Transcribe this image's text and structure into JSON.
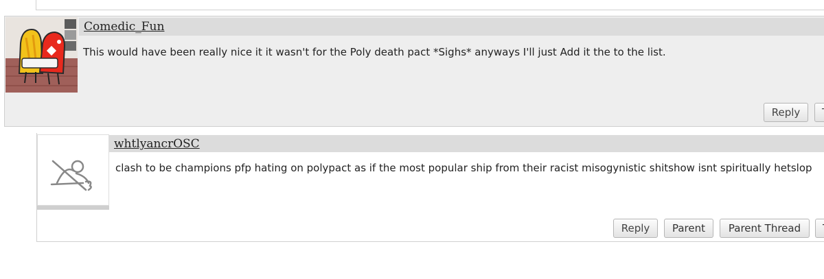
{
  "comments": [
    {
      "username": "Comedic_Fun",
      "text": "This would have been really nice it it wasn't for the Poly death pact *Sighs* anyways I'll just Add it the to the list.",
      "buttons": {
        "reply": "Reply",
        "more": "T"
      }
    },
    {
      "username": "whtlyancrOSC",
      "text": "clash to be champions pfp hating on polypact as if the most popular ship from their racist misogynistic shitshow isnt spiritually hetslop",
      "buttons": {
        "reply": "Reply",
        "parent": "Parent",
        "parent_thread": "Parent Thread",
        "more": "T"
      }
    }
  ],
  "icons": {
    "avatar1": "cartoon-characters-avatar-icon",
    "avatar2": "crossed-out-sketch-avatar-icon"
  },
  "colors": {
    "comment_bg": "#eeeeee",
    "username_bar": "#dcdcdc",
    "border": "#cfcfcf"
  }
}
